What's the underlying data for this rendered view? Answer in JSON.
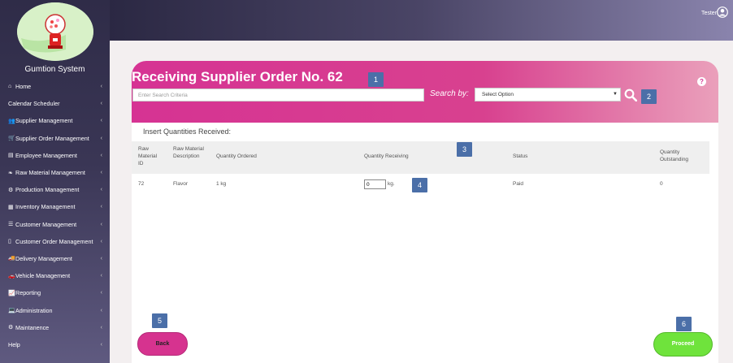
{
  "sidebar": {
    "app_name": "Gumtion System",
    "items": [
      {
        "label": "Home",
        "icon": "home-icon",
        "glyph": "⌂"
      },
      {
        "label": "Calendar Scheduler",
        "icon": "",
        "glyph": ""
      },
      {
        "label": "Supplier Management",
        "icon": "users-icon",
        "glyph": "👥"
      },
      {
        "label": "Supplier Order Management",
        "icon": "cart-icon",
        "glyph": "🛒"
      },
      {
        "label": "Employee Management",
        "icon": "id-card-icon",
        "glyph": "▤"
      },
      {
        "label": "Raw Material Management",
        "icon": "leaf-icon",
        "glyph": "❧"
      },
      {
        "label": "Production Management",
        "icon": "cogs-icon",
        "glyph": "⚙"
      },
      {
        "label": "Inventory Management",
        "icon": "grid-icon",
        "glyph": "▦"
      },
      {
        "label": "Customer Management",
        "icon": "list-icon",
        "glyph": "☰"
      },
      {
        "label": "Customer Order Management",
        "icon": "file-icon",
        "glyph": "▯"
      },
      {
        "label": "Delivery Management",
        "icon": "truck-icon",
        "glyph": "🚚"
      },
      {
        "label": "Vehicle Management",
        "icon": "car-icon",
        "glyph": "🚗"
      },
      {
        "label": "Reporting",
        "icon": "chart-icon",
        "glyph": "📈"
      },
      {
        "label": "Administration",
        "icon": "laptop-icon",
        "glyph": "💻"
      },
      {
        "label": "Maintanence",
        "icon": "gear-icon",
        "glyph": "⚙"
      },
      {
        "label": "Help",
        "icon": "",
        "glyph": ""
      }
    ],
    "chevron": "‹"
  },
  "topbar": {
    "user_name": "Tester"
  },
  "page": {
    "title": "Receiving Supplier Order No. 62",
    "search_placeholder": "Enter Search Criteria",
    "search_by_label": "Search by:",
    "select_value": "Select Option",
    "section_label": "Insert Quantities Received:",
    "help": "?"
  },
  "table": {
    "headers": {
      "raw_material_id": "Raw Material ID",
      "raw_material_desc": "Raw Material Description",
      "qty_ordered": "Quantity Ordered",
      "qty_receiving": "Quantity Receiving",
      "status": "Status",
      "qty_outstanding": "Quantity Outstanding"
    },
    "rows": [
      {
        "id": "72",
        "description": "Flavor",
        "ordered": "1 kg",
        "receiving": "0",
        "unit": "kg.",
        "status": "Paid",
        "outstanding": "0"
      }
    ]
  },
  "buttons": {
    "back": "Back",
    "proceed": "Proceed"
  },
  "badges": [
    "1",
    "2",
    "3",
    "4",
    "5",
    "6"
  ],
  "colors": {
    "accent_pink": "#d63393",
    "proceed_green": "#6fe33c",
    "badge_blue": "#4b6fa8",
    "sidebar_dark": "#2f2c48"
  }
}
